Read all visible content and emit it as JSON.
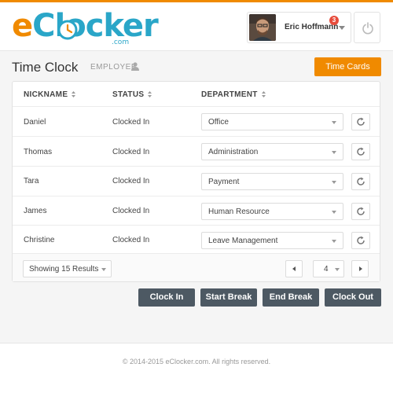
{
  "brand": {
    "logo_e": "e",
    "logo_rest": "Clocker",
    "logo_sub": ".com",
    "accent_orange": "#f08a00",
    "accent_blue": "#2aa6c8"
  },
  "header": {
    "user_name": "Eric Hoffmann",
    "notification_count": "3",
    "power_icon": "power-icon",
    "caret_icon": "chevron-down-icon"
  },
  "page": {
    "title": "Time Clock",
    "subtitle": "EMPLOYEE",
    "time_cards_label": "Time Cards"
  },
  "table": {
    "columns": [
      "NICKNAME",
      "STATUS",
      "DEPARTMENT"
    ],
    "rows": [
      {
        "nickname": "Daniel",
        "status": "Clocked In",
        "department": "Office"
      },
      {
        "nickname": "Thomas",
        "status": "Clocked In",
        "department": "Administration"
      },
      {
        "nickname": "Tara",
        "status": "Clocked In",
        "department": "Payment"
      },
      {
        "nickname": "James",
        "status": "Clocked In",
        "department": "Human Resource"
      },
      {
        "nickname": "Christine",
        "status": "Clocked In",
        "department": "Leave Management"
      }
    ],
    "results_label": "Showing 15 Results",
    "current_page": "4"
  },
  "actions": {
    "clock_in": "Clock In",
    "start_break": "Start Break",
    "end_break": "End Break",
    "clock_out": "Clock Out",
    "button_color": "#4d5963"
  },
  "footer": {
    "copyright": "© 2014-2015 eClocker.com. All rights reserved."
  }
}
